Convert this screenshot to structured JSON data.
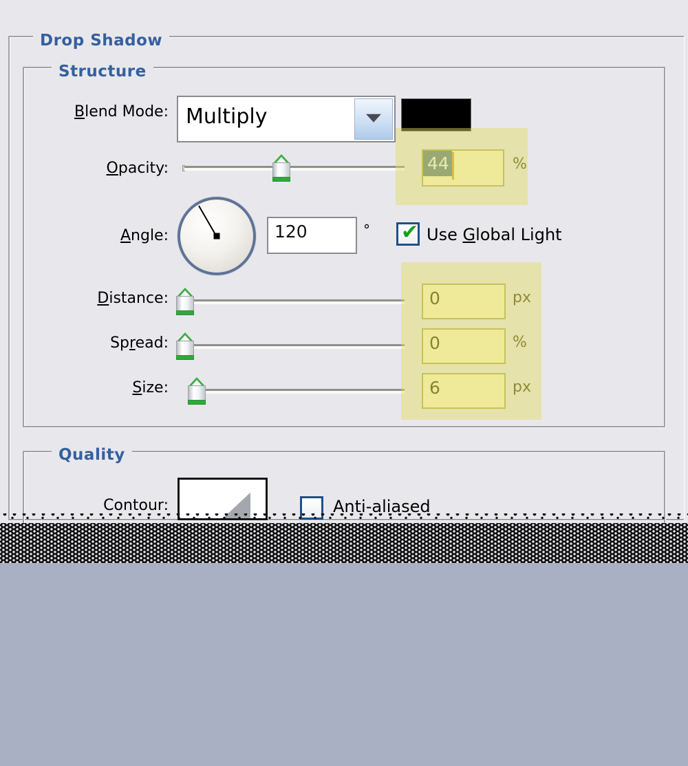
{
  "dialog": {
    "title": "Drop Shadow"
  },
  "structure": {
    "title": "Structure",
    "blend_mode": {
      "label": "Blend Mode:",
      "label_accel": "B",
      "value": "Multiply",
      "swatch_color": "#000000",
      "dropdown_icon": "chevron-down-icon"
    },
    "opacity": {
      "label": "Opacity:",
      "label_accel": "O",
      "value": "44",
      "unit": "%",
      "slider_percent": 44
    },
    "angle": {
      "label": "Angle:",
      "label_accel": "A",
      "value": "120",
      "unit": "°",
      "dial_degrees": 120
    },
    "use_global_light": {
      "label": "Use Global Light",
      "label_accel": "G",
      "checked": true
    },
    "distance": {
      "label": "Distance:",
      "label_accel": "D",
      "value": "0",
      "unit": "px",
      "slider_percent": 0
    },
    "spread": {
      "label": "Spread:",
      "label_accel": "r",
      "value": "0",
      "unit": "%",
      "slider_percent": 0
    },
    "size": {
      "label": "Size:",
      "label_accel": "S",
      "value": "6",
      "unit": "px",
      "slider_percent": 4
    }
  },
  "quality": {
    "title": "Quality",
    "contour": {
      "label": "Contour:"
    },
    "anti_aliased": {
      "label": "Anti-aliased",
      "checked": false
    }
  },
  "colors": {
    "panel_bg": "#e8e8ec",
    "group_border": "#a0a0a6",
    "heading_blue": "#35609f",
    "highlight_yellow": "#e2db60",
    "selection_teal": "#5f7f84",
    "desktop_blue": "#aab0c3"
  }
}
